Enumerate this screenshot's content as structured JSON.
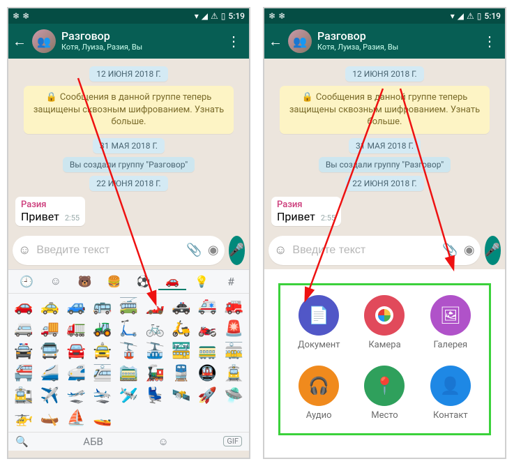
{
  "status": {
    "time": "5:19",
    "left_icons": [
      "❄",
      "❄"
    ],
    "right_icons": [
      "▾",
      "◢",
      "⚠",
      "▯"
    ]
  },
  "appbar": {
    "title": "Разговор",
    "subtitle": "Котя, Луиза, Разия, Вы"
  },
  "chat": {
    "date1": "12 ИЮНЯ 2018 Г.",
    "encryption": "Сообщения в данной группе теперь защищены сквозным шифрованием. Узнать больше.",
    "date2": "31 МАЯ 2018 Г.",
    "system": "Вы создали группу \"Разговор\"",
    "date3": "22 ИЮНЯ 2018 Г.",
    "message": {
      "sender": "Разия",
      "text": "Привет",
      "time": "2:55"
    }
  },
  "input": {
    "placeholder": "Введите текст"
  },
  "emoji_tabs": [
    "🕘",
    "☺",
    "🐻",
    "🍔",
    "⚽",
    "🚗",
    "💡",
    "#"
  ],
  "emoji_active_index": 5,
  "emoji_grid": [
    "🚗",
    "🚕",
    "🚙",
    "🚌",
    "🚎",
    "🏎️",
    "🚓",
    "🚑",
    "🚒",
    "🚐",
    "🚚",
    "🚛",
    "🚜",
    "🛴",
    "🚲",
    "🛵",
    "🏍️",
    "🚨",
    "🚔",
    "🚍",
    "🚘",
    "🚖",
    "🚡",
    "🚠",
    "🚟",
    "🚃",
    "🚋",
    "🚝",
    "🚄",
    "🚅",
    "🚈",
    "🚞",
    "🚂",
    "🚆",
    "🚇",
    "🚊",
    "🚉",
    "✈️",
    "🛫",
    "🛬",
    "🛩️",
    "💺",
    "🛰️",
    "🚀",
    "🛸",
    "🚁",
    "🛶",
    "⛵",
    "🚤"
  ],
  "kb_bottom": {
    "search": "🔍",
    "abc": "АБВ",
    "emoji": "☺",
    "gif": "GIF"
  },
  "attach": {
    "items": [
      {
        "key": "doc",
        "label": "Документ",
        "icon": "📄",
        "cls": "c-doc"
      },
      {
        "key": "camera",
        "label": "Камера",
        "icon": "cam",
        "cls": "c-cam"
      },
      {
        "key": "gallery",
        "label": "Галерея",
        "icon": "🖼",
        "cls": "c-gal"
      },
      {
        "key": "audio",
        "label": "Аудио",
        "icon": "🎧",
        "cls": "c-aud"
      },
      {
        "key": "location",
        "label": "Место",
        "icon": "📍",
        "cls": "c-loc"
      },
      {
        "key": "contact",
        "label": "Контакт",
        "icon": "👤",
        "cls": "c-con"
      }
    ]
  }
}
